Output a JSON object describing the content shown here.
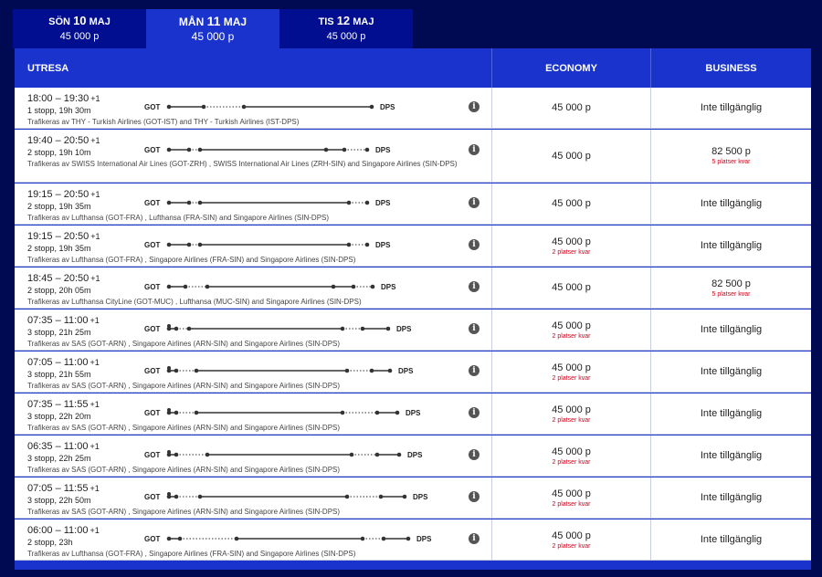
{
  "date_tabs": [
    {
      "weekday": "SÖN",
      "daynum": "10",
      "month": "MAJ",
      "price": "45 000 p",
      "active": false
    },
    {
      "weekday": "MÅN",
      "daynum": "11",
      "month": "MAJ",
      "price": "45 000 p",
      "active": true
    },
    {
      "weekday": "TIS",
      "daynum": "12",
      "month": "MAJ",
      "price": "45 000 p",
      "active": false
    }
  ],
  "header": {
    "outbound": "UTRESA",
    "economy": "ECONOMY",
    "business": "BUSINESS"
  },
  "flights": [
    {
      "time": "18:00 – 19:30",
      "plus": "+1",
      "stops": "1 stopp, 19h 30m",
      "operated": "Trafikeras av THY - Turkish Airlines (GOT-IST) and THY - Turkish Airlines (IST-DPS)",
      "from": "GOT",
      "to": "DPS",
      "economy": {
        "price": "45 000 p",
        "seats": ""
      },
      "business": {
        "price": "Inte tillgänglig",
        "seats": ""
      }
    },
    {
      "time": "19:40 – 20:50",
      "plus": "+1",
      "stops": "2 stopp, 19h 10m",
      "operated": "Trafikeras av SWISS International Air Lines (GOT-ZRH) , SWISS International Air Lines (ZRH-SIN) and Singapore Airlines (SIN-DPS)",
      "from": "GOT",
      "to": "DPS",
      "economy": {
        "price": "45 000 p",
        "seats": ""
      },
      "business": {
        "price": "82 500 p",
        "seats": "5 platser kvar"
      }
    },
    {
      "time": "19:15 – 20:50",
      "plus": "+1",
      "stops": "2 stopp, 19h 35m",
      "operated": "Trafikeras av Lufthansa (GOT-FRA) , Lufthansa (FRA-SIN) and Singapore Airlines (SIN-DPS)",
      "from": "GOT",
      "to": "DPS",
      "economy": {
        "price": "45 000 p",
        "seats": ""
      },
      "business": {
        "price": "Inte tillgänglig",
        "seats": ""
      }
    },
    {
      "time": "19:15 – 20:50",
      "plus": "+1",
      "stops": "2 stopp, 19h 35m",
      "operated": "Trafikeras av Lufthansa (GOT-FRA) , Singapore Airlines (FRA-SIN) and Singapore Airlines (SIN-DPS)",
      "from": "GOT",
      "to": "DPS",
      "economy": {
        "price": "45 000 p",
        "seats": "2 platser kvar"
      },
      "business": {
        "price": "Inte tillgänglig",
        "seats": ""
      }
    },
    {
      "time": "18:45 – 20:50",
      "plus": "+1",
      "stops": "2 stopp, 20h 05m",
      "operated": "Trafikeras av Lufthansa CityLine (GOT-MUC) , Lufthansa (MUC-SIN) and Singapore Airlines (SIN-DPS)",
      "from": "GOT",
      "to": "DPS",
      "economy": {
        "price": "45 000 p",
        "seats": ""
      },
      "business": {
        "price": "82 500 p",
        "seats": "5 platser kvar"
      }
    },
    {
      "time": "07:35 – 11:00",
      "plus": "+1",
      "stops": "3 stopp, 21h 25m",
      "operated": "Trafikeras av SAS (GOT-ARN) , Singapore Airlines (ARN-SIN) and Singapore Airlines (SIN-DPS)",
      "from": "GOT",
      "to": "DPS",
      "economy": {
        "price": "45 000 p",
        "seats": "2 platser kvar"
      },
      "business": {
        "price": "Inte tillgänglig",
        "seats": ""
      }
    },
    {
      "time": "07:05 – 11:00",
      "plus": "+1",
      "stops": "3 stopp, 21h 55m",
      "operated": "Trafikeras av SAS (GOT-ARN) , Singapore Airlines (ARN-SIN) and Singapore Airlines (SIN-DPS)",
      "from": "GOT",
      "to": "DPS",
      "economy": {
        "price": "45 000 p",
        "seats": "2 platser kvar"
      },
      "business": {
        "price": "Inte tillgänglig",
        "seats": ""
      }
    },
    {
      "time": "07:35 – 11:55",
      "plus": "+1",
      "stops": "3 stopp, 22h 20m",
      "operated": "Trafikeras av SAS (GOT-ARN) , Singapore Airlines (ARN-SIN) and Singapore Airlines (SIN-DPS)",
      "from": "GOT",
      "to": "DPS",
      "economy": {
        "price": "45 000 p",
        "seats": "2 platser kvar"
      },
      "business": {
        "price": "Inte tillgänglig",
        "seats": ""
      }
    },
    {
      "time": "06:35 – 11:00",
      "plus": "+1",
      "stops": "3 stopp, 22h 25m",
      "operated": "Trafikeras av SAS (GOT-ARN) , Singapore Airlines (ARN-SIN) and Singapore Airlines (SIN-DPS)",
      "from": "GOT",
      "to": "DPS",
      "economy": {
        "price": "45 000 p",
        "seats": "2 platser kvar"
      },
      "business": {
        "price": "Inte tillgänglig",
        "seats": ""
      }
    },
    {
      "time": "07:05 – 11:55",
      "plus": "+1",
      "stops": "3 stopp, 22h 50m",
      "operated": "Trafikeras av SAS (GOT-ARN) , Singapore Airlines (ARN-SIN) and Singapore Airlines (SIN-DPS)",
      "from": "GOT",
      "to": "DPS",
      "economy": {
        "price": "45 000 p",
        "seats": "2 platser kvar"
      },
      "business": {
        "price": "Inte tillgänglig",
        "seats": ""
      }
    },
    {
      "time": "06:00 – 11:00",
      "plus": "+1",
      "stops": "2 stopp, 23h",
      "operated": "Trafikeras av Lufthansa (GOT-FRA) , Singapore Airlines (FRA-SIN) and Singapore Airlines (SIN-DPS)",
      "from": "GOT",
      "to": "DPS",
      "economy": {
        "price": "45 000 p",
        "seats": "2 platser kvar"
      },
      "business": {
        "price": "Inte tillgänglig",
        "seats": ""
      }
    }
  ],
  "colors": {
    "page_bg": "#000a52",
    "tab_bg": "#000e8f",
    "tab_active": "#1a33cc",
    "header_bg": "#1a33cc",
    "seats_red": "#d0021b"
  },
  "icons": {
    "info": "info-icon",
    "route": "route-timeline-icon",
    "tap": "transfer-walk-icon"
  }
}
